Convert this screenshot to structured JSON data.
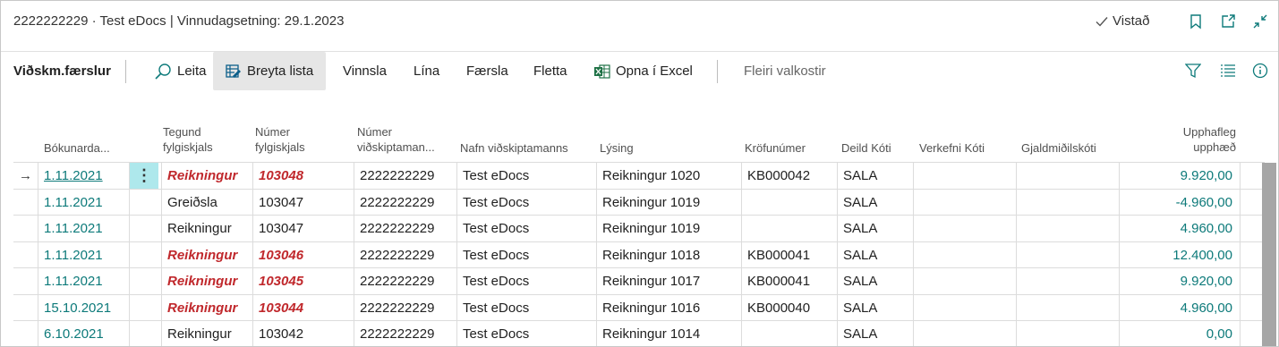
{
  "window": {
    "title": "2222222229 · Test eDocs | Vinnudagsetning: 29.1.2023",
    "saved_label": "Vistað",
    "saved_icon": "check-icon"
  },
  "actions": {
    "page_title": "Viðskm.færslur",
    "search": "Leita",
    "edit_list": "Breyta lista",
    "process": "Vinnsla",
    "line": "Lína",
    "entry": "Færsla",
    "navigate": "Fletta",
    "open_excel": "Opna í Excel",
    "more": "Fleiri valkostir"
  },
  "columns": {
    "posting_date": "Bókunarda...",
    "doc_type": [
      "Tegund",
      "fylgiskjals"
    ],
    "doc_no": [
      "Númer",
      "fylgiskjals"
    ],
    "cust_no": [
      "Númer",
      "viðskiptaman..."
    ],
    "cust_name": "Nafn viðskiptamanns",
    "description": "Lýsing",
    "claim_no": "Kröfunúmer",
    "dept": "Deild Kóti",
    "project": "Verkefni Kóti",
    "currency": "Gjaldmiðilskóti",
    "orig_amount": [
      "Upphafleg",
      "upphæð"
    ]
  },
  "rows": [
    {
      "date": "1.11.2021",
      "type": "Reikningur",
      "doc": "103048",
      "cust": "2222222229",
      "name": "Test eDocs",
      "desc": "Reikningur 1020",
      "claim": "KB000042",
      "dept": "SALA",
      "project": "",
      "currency": "",
      "amount": "9.920,00",
      "highlight": true,
      "current": true
    },
    {
      "date": "1.11.2021",
      "type": "Greiðsla",
      "doc": "103047",
      "cust": "2222222229",
      "name": "Test eDocs",
      "desc": "Reikningur 1019",
      "claim": "",
      "dept": "SALA",
      "project": "",
      "currency": "",
      "amount": "-4.960,00",
      "highlight": false
    },
    {
      "date": "1.11.2021",
      "type": "Reikningur",
      "doc": "103047",
      "cust": "2222222229",
      "name": "Test eDocs",
      "desc": "Reikningur 1019",
      "claim": "",
      "dept": "SALA",
      "project": "",
      "currency": "",
      "amount": "4.960,00",
      "highlight": false
    },
    {
      "date": "1.11.2021",
      "type": "Reikningur",
      "doc": "103046",
      "cust": "2222222229",
      "name": "Test eDocs",
      "desc": "Reikningur 1018",
      "claim": "KB000041",
      "dept": "SALA",
      "project": "",
      "currency": "",
      "amount": "12.400,00",
      "highlight": true
    },
    {
      "date": "1.11.2021",
      "type": "Reikningur",
      "doc": "103045",
      "cust": "2222222229",
      "name": "Test eDocs",
      "desc": "Reikningur 1017",
      "claim": "KB000041",
      "dept": "SALA",
      "project": "",
      "currency": "",
      "amount": "9.920,00",
      "highlight": true
    },
    {
      "date": "15.10.2021",
      "type": "Reikningur",
      "doc": "103044",
      "cust": "2222222229",
      "name": "Test eDocs",
      "desc": "Reikningur 1016",
      "claim": "KB000040",
      "dept": "SALA",
      "project": "",
      "currency": "",
      "amount": "4.960,00",
      "highlight": true
    },
    {
      "date": "6.10.2021",
      "type": "Reikningur",
      "doc": "103042",
      "cust": "2222222229",
      "name": "Test eDocs",
      "desc": "Reikningur 1014",
      "claim": "",
      "dept": "SALA",
      "project": "",
      "currency": "",
      "amount": "0,00",
      "highlight": false
    }
  ],
  "colors": {
    "accent": "#0d7a7a",
    "overdue_red": "#c0282c",
    "selected_action_bg": "#e6e6e6",
    "row_menu_bg": "#aee8ec"
  }
}
